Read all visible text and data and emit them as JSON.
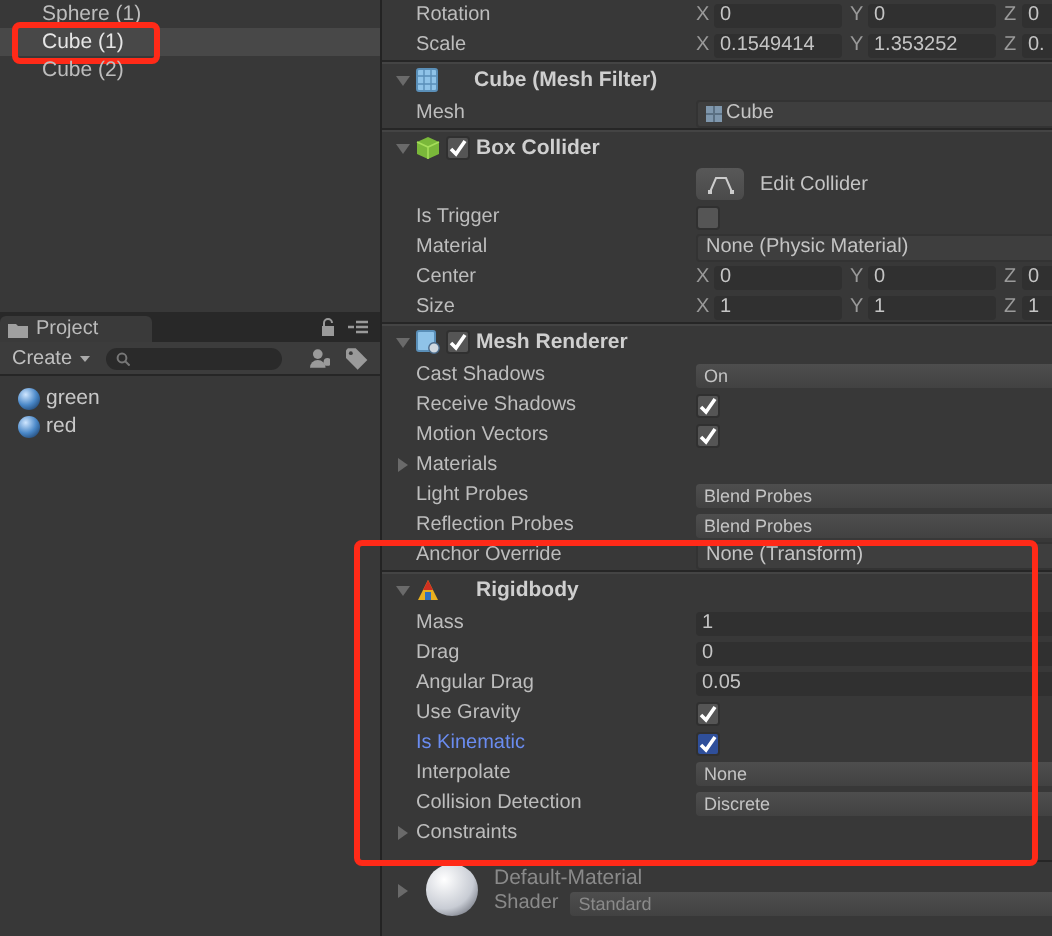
{
  "hierarchy": {
    "items": [
      {
        "label": "Sphere (1)",
        "selected": false,
        "framed": false
      },
      {
        "label": "Cube (1)",
        "selected": true,
        "framed": true
      },
      {
        "label": "Cube (2)",
        "selected": false,
        "framed": false
      }
    ]
  },
  "project": {
    "tab": "Project",
    "create": "Create",
    "assets": [
      {
        "label": "green"
      },
      {
        "label": "red"
      }
    ]
  },
  "inspector": {
    "transform_rows": [
      {
        "kind": "vector",
        "label": "Rotation",
        "fields": [
          {
            "axis": "X",
            "value": "0"
          },
          {
            "axis": "Y",
            "value": "0"
          },
          {
            "axis": "Z",
            "value": "0"
          }
        ]
      },
      {
        "kind": "vector",
        "label": "Scale",
        "fields": [
          {
            "axis": "X",
            "value": "0.1549414"
          },
          {
            "axis": "Y",
            "value": "1.353252"
          },
          {
            "axis": "Z",
            "value": "0."
          }
        ]
      }
    ],
    "components": [
      {
        "kind": "mesh-filter",
        "title": "Cube (Mesh Filter)",
        "expanded": true,
        "framed": false,
        "rows": [
          {
            "kind": "asset",
            "label": "Mesh",
            "value": "Cube"
          }
        ]
      },
      {
        "kind": "box-collider",
        "title": "Box Collider",
        "enabled": true,
        "expanded": true,
        "framed": false,
        "rows": [
          {
            "kind": "button",
            "value": "Edit Collider"
          },
          {
            "kind": "checkbox",
            "label": "Is Trigger",
            "checked": false,
            "highlighted": false
          },
          {
            "kind": "object",
            "label": "Material",
            "value": "None (Physic Material)"
          },
          {
            "kind": "vector",
            "label": "Center",
            "fields": [
              {
                "axis": "X",
                "value": "0"
              },
              {
                "axis": "Y",
                "value": "0"
              },
              {
                "axis": "Z",
                "value": "0"
              }
            ]
          },
          {
            "kind": "vector",
            "label": "Size",
            "fields": [
              {
                "axis": "X",
                "value": "1"
              },
              {
                "axis": "Y",
                "value": "1"
              },
              {
                "axis": "Z",
                "value": "1"
              }
            ]
          }
        ]
      },
      {
        "kind": "mesh-renderer",
        "title": "Mesh Renderer",
        "enabled": true,
        "expanded": true,
        "framed": false,
        "rows": [
          {
            "kind": "dropdown",
            "label": "Cast Shadows",
            "value": "On"
          },
          {
            "kind": "checkbox",
            "label": "Receive Shadows",
            "checked": true,
            "highlighted": false
          },
          {
            "kind": "checkbox",
            "label": "Motion Vectors",
            "checked": true,
            "highlighted": false
          },
          {
            "kind": "foldout",
            "label": "Materials",
            "expanded": false
          },
          {
            "kind": "dropdown",
            "label": "Light Probes",
            "value": "Blend Probes"
          },
          {
            "kind": "dropdown",
            "label": "Reflection Probes",
            "value": "Blend Probes"
          },
          {
            "kind": "object",
            "label": "Anchor Override",
            "value": "None (Transform)"
          }
        ]
      },
      {
        "kind": "rigidbody",
        "title": "Rigidbody",
        "expanded": true,
        "framed": true,
        "rows": [
          {
            "kind": "text",
            "label": "Mass",
            "value": "1"
          },
          {
            "kind": "text",
            "label": "Drag",
            "value": "0"
          },
          {
            "kind": "text",
            "label": "Angular Drag",
            "value": "0.05"
          },
          {
            "kind": "checkbox",
            "label": "Use Gravity",
            "checked": true,
            "highlighted": false
          },
          {
            "kind": "checkbox",
            "label": "Is Kinematic",
            "checked": true,
            "highlighted": true
          },
          {
            "kind": "dropdown",
            "label": "Interpolate",
            "value": "None"
          },
          {
            "kind": "dropdown",
            "label": "Collision Detection",
            "value": "Discrete"
          },
          {
            "kind": "foldout",
            "label": "Constraints",
            "expanded": false
          }
        ]
      }
    ],
    "material": {
      "name": "Default-Material",
      "shader_label": "Shader",
      "shader": "Standard",
      "expanded": false
    }
  }
}
